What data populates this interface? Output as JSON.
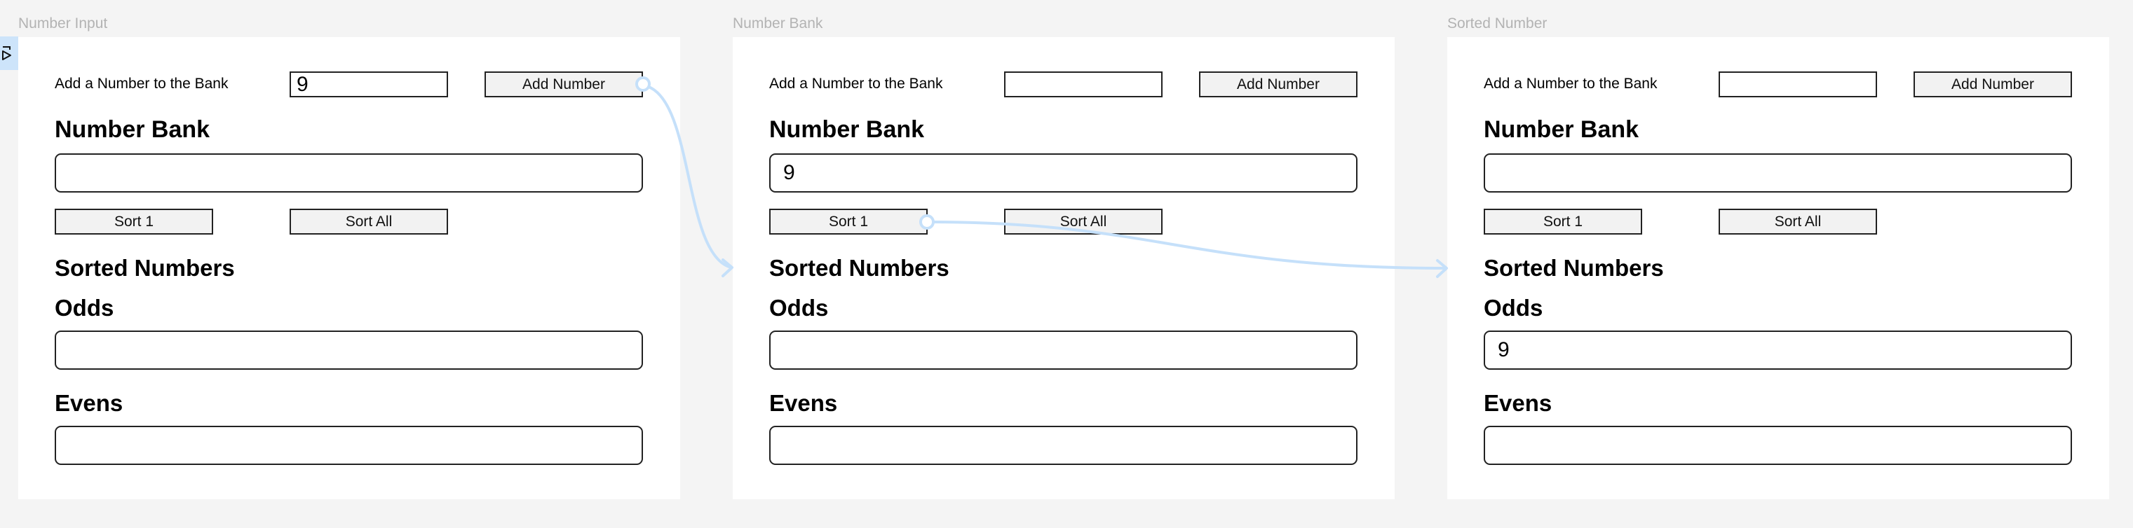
{
  "frames": [
    {
      "label": "Number Input",
      "prompt": "Add a Number to the Bank",
      "input_value": "9",
      "add_button": "Add Number",
      "bank_heading": "Number Bank",
      "bank_value": "",
      "sort1_button": "Sort 1",
      "sortall_button": "Sort All",
      "sorted_heading": "Sorted Numbers",
      "odds_heading": "Odds",
      "odds_value": "",
      "evens_heading": "Evens",
      "evens_value": ""
    },
    {
      "label": "Number Bank",
      "prompt": "Add a Number to the Bank",
      "input_value": "",
      "add_button": "Add Number",
      "bank_heading": "Number Bank",
      "bank_value": "9",
      "sort1_button": "Sort 1",
      "sortall_button": "Sort All",
      "sorted_heading": "Sorted Numbers",
      "odds_heading": "Odds",
      "odds_value": "",
      "evens_heading": "Evens",
      "evens_value": ""
    },
    {
      "label": "Sorted Number",
      "prompt": "Add a Number to the Bank",
      "input_value": "",
      "add_button": "Add Number",
      "bank_heading": "Number Bank",
      "bank_value": "",
      "sort1_button": "Sort 1",
      "sortall_button": "Sort All",
      "sorted_heading": "Sorted Numbers",
      "odds_heading": "Odds",
      "odds_value": "9",
      "evens_heading": "Evens",
      "evens_value": ""
    }
  ],
  "flow_start_icon": "prototype-flow-start-icon",
  "connections": [
    {
      "from": "Number Input / Add Number",
      "to": "Number Bank"
    },
    {
      "from": "Number Bank / Sort 1",
      "to": "Sorted Number"
    }
  ],
  "colors": {
    "canvas": "#f4f4f4",
    "frame": "#ffffff",
    "connector": "#c5e0fa",
    "button_fill": "#f2f2f2",
    "frame_label": "#b3b3b3"
  }
}
